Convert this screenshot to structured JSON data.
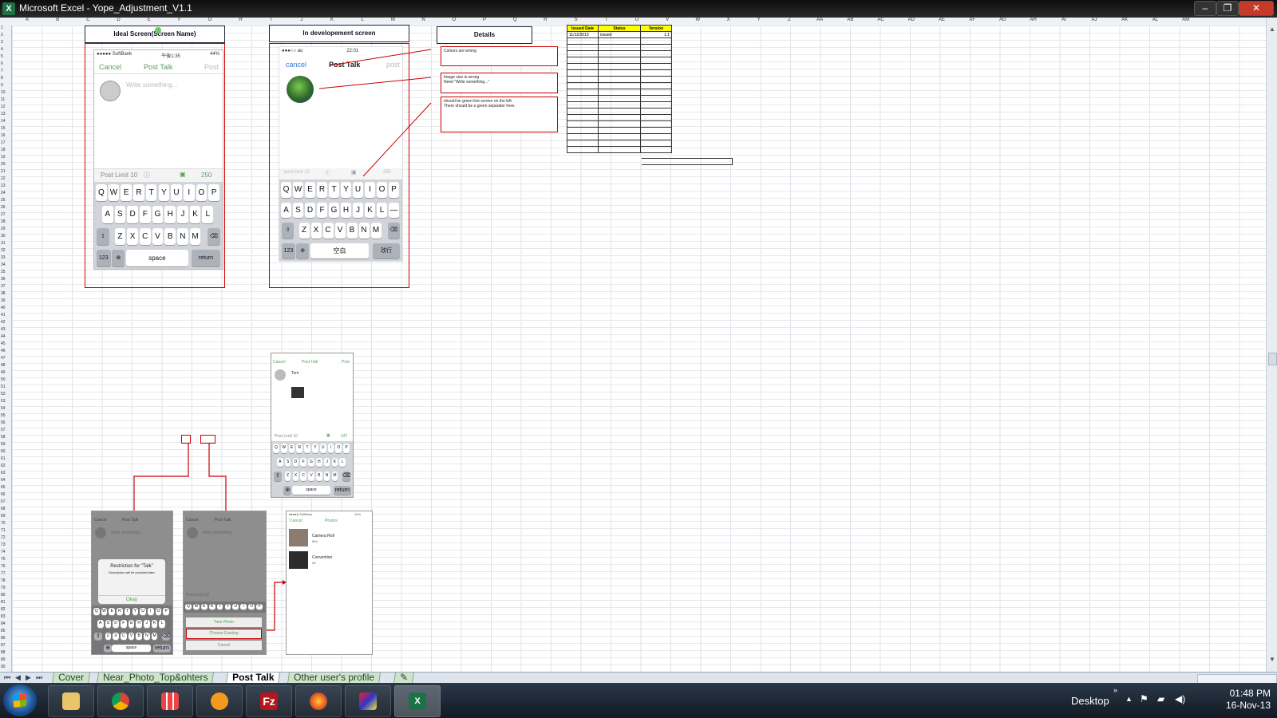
{
  "window": {
    "title": "Microsoft Excel - Yope_Adjustment_V1.1",
    "app_icon": "excel-icon"
  },
  "columns": [
    "A",
    "B",
    "C",
    "D",
    "E",
    "F",
    "G",
    "H",
    "I",
    "J",
    "K",
    "L",
    "M",
    "N",
    "O",
    "P",
    "Q",
    "R",
    "S",
    "T",
    "U",
    "V",
    "W",
    "X",
    "Y",
    "Z",
    "AA",
    "AB",
    "AC",
    "AD",
    "AE",
    "AF",
    "AG",
    "AH",
    "AI",
    "AJ",
    "AK",
    "AL",
    "AM"
  ],
  "headers": {
    "ideal": "Ideal Screen(Screen Name)",
    "dev": "In developement screen",
    "details": "Details"
  },
  "ideal_phone": {
    "status_left": "●●●●● SoftBank",
    "status_mid": "午後1:35",
    "status_right": "44%",
    "cancel": "Cancel",
    "title": "Post Talk",
    "post": "Post",
    "placeholder": "Write something...",
    "post_limit": "Post Limit 10",
    "count": "250",
    "row1": [
      "Q",
      "W",
      "E",
      "R",
      "T",
      "Y",
      "U",
      "I",
      "O",
      "P"
    ],
    "row2": [
      "A",
      "S",
      "D",
      "F",
      "G",
      "H",
      "J",
      "K",
      "L"
    ],
    "row3": [
      "Z",
      "X",
      "C",
      "V",
      "B",
      "N",
      "M"
    ],
    "num": "123",
    "space": "space",
    "return": "return"
  },
  "dev_phone": {
    "status_left": "●●●○○ au",
    "status_mid": "22:01",
    "cancel": "cancel",
    "title": "Post Talk",
    "post": "post",
    "post_limit": "post limit 10",
    "count": "250",
    "row1": [
      "Q",
      "W",
      "E",
      "R",
      "T",
      "Y",
      "U",
      "I",
      "O",
      "P"
    ],
    "row2": [
      "A",
      "S",
      "D",
      "F",
      "G",
      "H",
      "J",
      "K",
      "L",
      "—"
    ],
    "row3": [
      "Z",
      "X",
      "C",
      "V",
      "B",
      "N",
      "M"
    ],
    "num": "123",
    "space": "空白",
    "return": "改行"
  },
  "notes": [
    {
      "text": "Colours are wrong"
    },
    {
      "text": "Image size is wrong\nNeed \"Write something...\""
    },
    {
      "text": "should be green line screen on the left.\nThere should be a green separator here."
    }
  ],
  "log_table": {
    "headers": [
      "Issued Date",
      "Status",
      "Version"
    ],
    "rows": [
      [
        "11/12/2013",
        "issued",
        "1.1"
      ]
    ],
    "empty_rows": 18
  },
  "mid_phone": {
    "cancel": "Cancel",
    "title": "Post Talk",
    "post": "Post",
    "user": "Tom",
    "post_limit": "Post Limit 10",
    "count": "247",
    "row1": [
      "Q",
      "W",
      "E",
      "R",
      "T",
      "Y",
      "U",
      "I",
      "O",
      "P"
    ],
    "row2": [
      "A",
      "S",
      "D",
      "F",
      "G",
      "H",
      "J",
      "K",
      "L"
    ],
    "row3": [
      "Z",
      "X",
      "C",
      "V",
      "B",
      "N",
      "M"
    ],
    "space": "space",
    "return": "return"
  },
  "restriction_phone": {
    "cancel": "Cancel",
    "title": "Post Talk",
    "placeholder": "Write something...",
    "alert_title": "Restriction for \"Talk\"",
    "alert_desc": "Description will be provided later",
    "alert_ok": "Okay",
    "row1": [
      "Q",
      "W",
      "E",
      "R",
      "T",
      "Y",
      "U",
      "I",
      "O",
      "P"
    ],
    "row2": [
      "A",
      "S",
      "D",
      "F",
      "G",
      "H",
      "J",
      "K",
      "L"
    ],
    "row3": [
      "Z",
      "X",
      "C",
      "V",
      "B",
      "N",
      "M"
    ],
    "space": "space",
    "return": "return"
  },
  "action_phone": {
    "cancel": "Cancel",
    "title": "Post Talk",
    "placeholder": "Write something...",
    "post_limit": "Post Limit 10",
    "row1": [
      "Q",
      "W",
      "E",
      "R",
      "T",
      "Y",
      "U",
      "I",
      "O",
      "P"
    ],
    "take_photo": "Take Photo",
    "choose_existing": "Choose Existing",
    "cancel_action": "Cancel"
  },
  "photos_phone": {
    "status_left": "●●●●● SoftBank",
    "status_right": "44%",
    "cancel": "Cancel",
    "title": "Photos",
    "albums": [
      {
        "name": "Camera Roll",
        "count": "654"
      },
      {
        "name": "Convention",
        "count": "25"
      }
    ]
  },
  "sheet_tabs": [
    "Cover",
    "Near_Photo_Top&ohters",
    "Post Talk",
    "Other user's profile"
  ],
  "active_tab": "Post Talk",
  "taskbar": {
    "apps": [
      "file-explorer-icon",
      "chrome-icon",
      "apps-grid-icon",
      "settings-gear-icon",
      "filezilla-icon",
      "firefox-icon",
      "paint-icon",
      "excel-taskbar-icon"
    ],
    "desktop_label": "Desktop",
    "time": "01:48 PM",
    "date": "16-Nov-13"
  },
  "colors": {
    "ios_green": "#5a9f57",
    "annotation_red": "#cc0000",
    "header_yellow": "#ffff00"
  }
}
